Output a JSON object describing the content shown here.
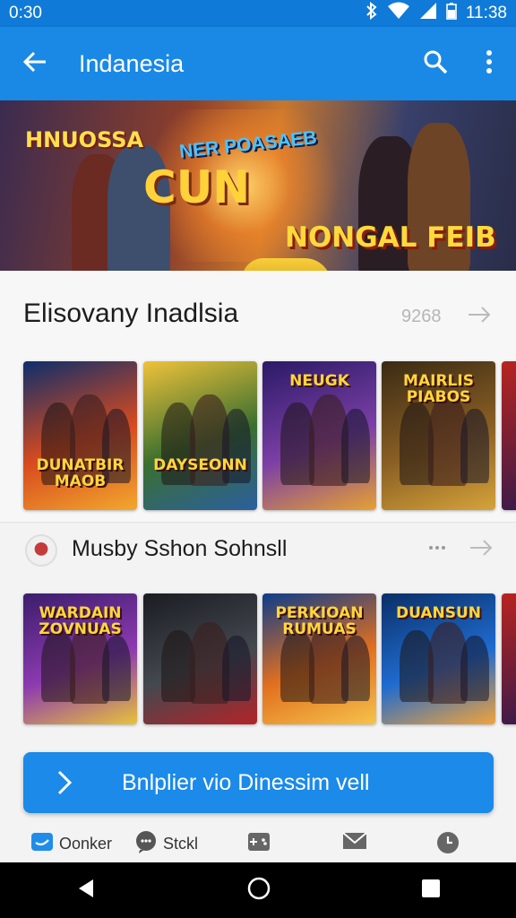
{
  "status_bar": {
    "time_left": "0:30",
    "time_right": "11:38"
  },
  "app_bar": {
    "title": "Indanesia"
  },
  "hero": {
    "title_top": "HNUOSSA",
    "subtitle": "NER POASAEB",
    "title_main": "CUN",
    "title_right": "NONGAL FEIB"
  },
  "section1": {
    "title": "Elisovany Inadlsia",
    "count": "9268",
    "cards": [
      {
        "label": "DUNATBIR MAOB",
        "colors": [
          "#0d2e6b",
          "#d84b1e",
          "#f2a82e"
        ]
      },
      {
        "label": "DAYSEONN",
        "colors": [
          "#f0c23a",
          "#3a6f2f",
          "#2b5fa0"
        ]
      },
      {
        "label": "NEUGK",
        "colors": [
          "#2a1a66",
          "#7b3fa6",
          "#e6a132"
        ]
      },
      {
        "label": "MAIRLIS PIABOS",
        "colors": [
          "#3a2a14",
          "#8a5f24",
          "#d6a33a"
        ]
      }
    ]
  },
  "section2": {
    "title": "Musby Sshon Sohnsll",
    "cards": [
      {
        "label": "WARDAIN ZOVNUAS",
        "colors": [
          "#3b1d6c",
          "#8c3ab0",
          "#e8c23b"
        ]
      },
      {
        "label": "",
        "colors": [
          "#1a1c22",
          "#44484f",
          "#b32428"
        ]
      },
      {
        "label": "PERKIOAN RUMUAS",
        "colors": [
          "#0d3c8a",
          "#e2701f",
          "#f5c34b"
        ]
      },
      {
        "label": "DUANSUN",
        "colors": [
          "#0a2f66",
          "#1f6bd0",
          "#f2a33a"
        ]
      }
    ]
  },
  "cta": {
    "label": "Bnlplier vio Dinessim vell"
  },
  "bottom_tabs": [
    {
      "label": "Oonker",
      "icon": "chat-square-icon"
    },
    {
      "label": "Stckl",
      "icon": "speech-bubble-icon"
    },
    {
      "label": "",
      "icon": "gamepad-icon"
    },
    {
      "label": "",
      "icon": "mail-icon"
    },
    {
      "label": "",
      "icon": "clock-icon"
    }
  ],
  "colors": {
    "primary": "#1a89e6",
    "status": "#0f7ad8"
  }
}
